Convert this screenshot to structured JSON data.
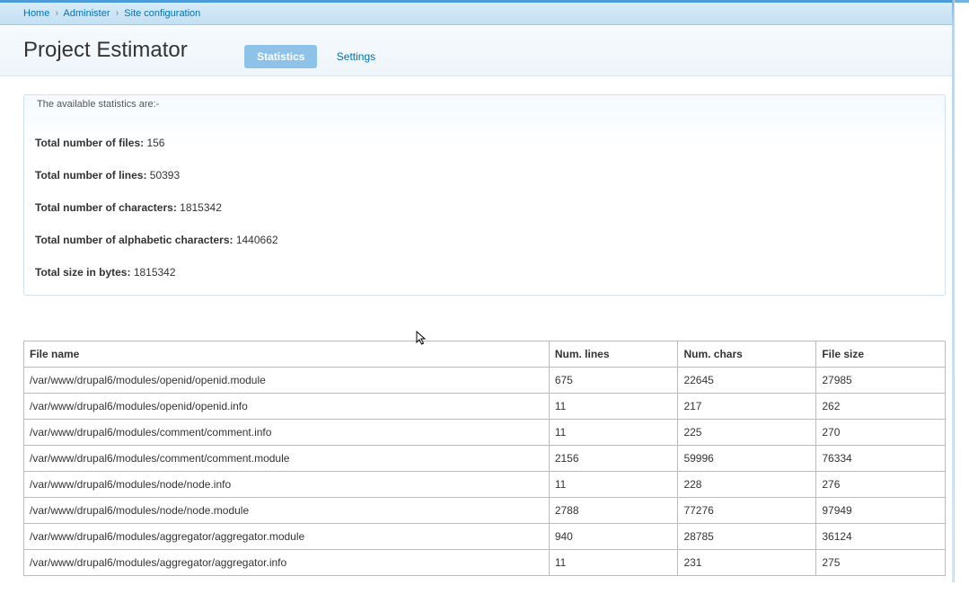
{
  "breadcrumb": {
    "items": [
      "Home",
      "Administer",
      "Site configuration"
    ],
    "sep": "›"
  },
  "page_title": "Project Estimator",
  "tabs": {
    "statistics": "Statistics",
    "settings": "Settings"
  },
  "fieldset_legend": "The available statistics are:-",
  "stats": {
    "files": {
      "label": "Total number of files: ",
      "value": "156"
    },
    "lines": {
      "label": "Total number of lines: ",
      "value": "50393"
    },
    "chars": {
      "label": "Total number of characters: ",
      "value": "1815342"
    },
    "alpha": {
      "label": "Total number of alphabetic characters: ",
      "value": "1440662"
    },
    "bytes": {
      "label": "Total size in bytes: ",
      "value": "1815342"
    }
  },
  "table": {
    "headers": {
      "name": "File name",
      "lines": "Num. lines",
      "chars": "Num. chars",
      "size": "File size"
    },
    "rows": [
      {
        "name": "/var/www/drupal6/modules/openid/openid.module",
        "lines": "675",
        "chars": "22645",
        "size": "27985"
      },
      {
        "name": "/var/www/drupal6/modules/openid/openid.info",
        "lines": "11",
        "chars": "217",
        "size": "262"
      },
      {
        "name": "/var/www/drupal6/modules/comment/comment.info",
        "lines": "11",
        "chars": "225",
        "size": "270"
      },
      {
        "name": "/var/www/drupal6/modules/comment/comment.module",
        "lines": "2156",
        "chars": "59996",
        "size": "76334"
      },
      {
        "name": "/var/www/drupal6/modules/node/node.info",
        "lines": "11",
        "chars": "228",
        "size": "276"
      },
      {
        "name": "/var/www/drupal6/modules/node/node.module",
        "lines": "2788",
        "chars": "77276",
        "size": "97949"
      },
      {
        "name": "/var/www/drupal6/modules/aggregator/aggregator.module",
        "lines": "940",
        "chars": "28785",
        "size": "36124"
      },
      {
        "name": "/var/www/drupal6/modules/aggregator/aggregator.info",
        "lines": "11",
        "chars": "231",
        "size": "275"
      }
    ]
  }
}
